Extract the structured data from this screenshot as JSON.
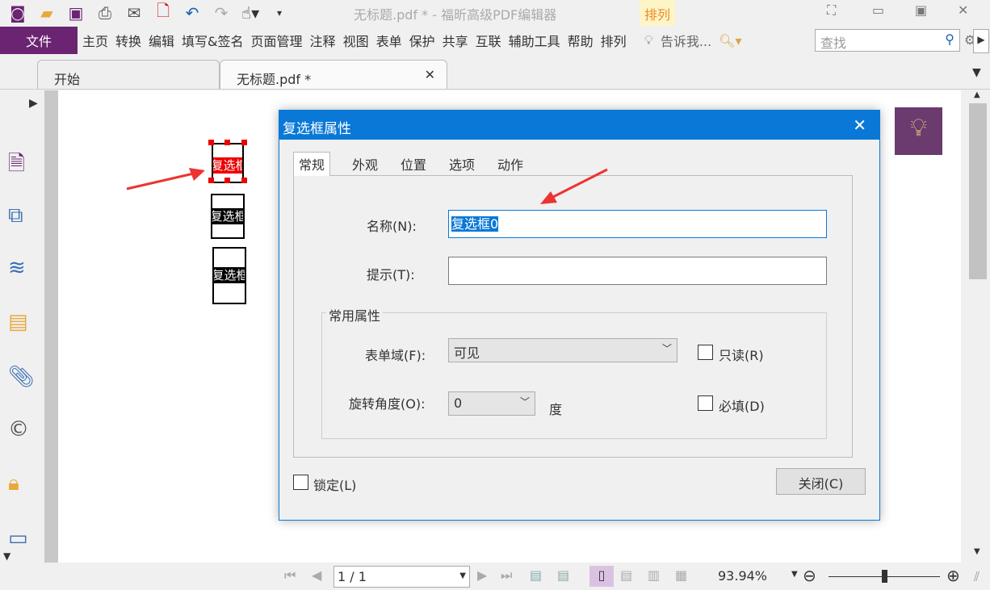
{
  "window": {
    "title": "无标题.pdf * - 福昕高级PDF编辑器",
    "context_tab": "排列"
  },
  "menu": {
    "file": "文件",
    "items": [
      "主页",
      "转换",
      "编辑",
      "填写&签名",
      "页面管理",
      "注释",
      "视图",
      "表单",
      "保护",
      "共享",
      "互联",
      "辅助工具",
      "帮助",
      "排列"
    ],
    "tell_me": "告诉我...",
    "search_placeholder": "查找"
  },
  "tabs": [
    {
      "label": "开始"
    },
    {
      "label": "无标题.pdf *"
    }
  ],
  "page": {
    "fields": [
      "复选框",
      "复选框",
      "复选框"
    ]
  },
  "dialog": {
    "title": "复选框属性",
    "tabs": [
      "常规",
      "外观",
      "位置",
      "选项",
      "动作"
    ],
    "name_label": "名称(N):",
    "name_value": "复选框0",
    "tip_label": "提示(T):",
    "tip_value": "",
    "group_label": "常用属性",
    "form_field_label": "表单域(F):",
    "form_field_value": "可见",
    "readonly_label": "只读(R)",
    "rotation_label": "旋转角度(O):",
    "rotation_value": "0",
    "rotation_unit": "度",
    "required_label": "必填(D)",
    "locked_label": "锁定(L)",
    "close_button": "关闭(C)"
  },
  "status": {
    "page": "1 / 1",
    "zoom": "93.94%",
    "zoom_slider": 0.5
  }
}
